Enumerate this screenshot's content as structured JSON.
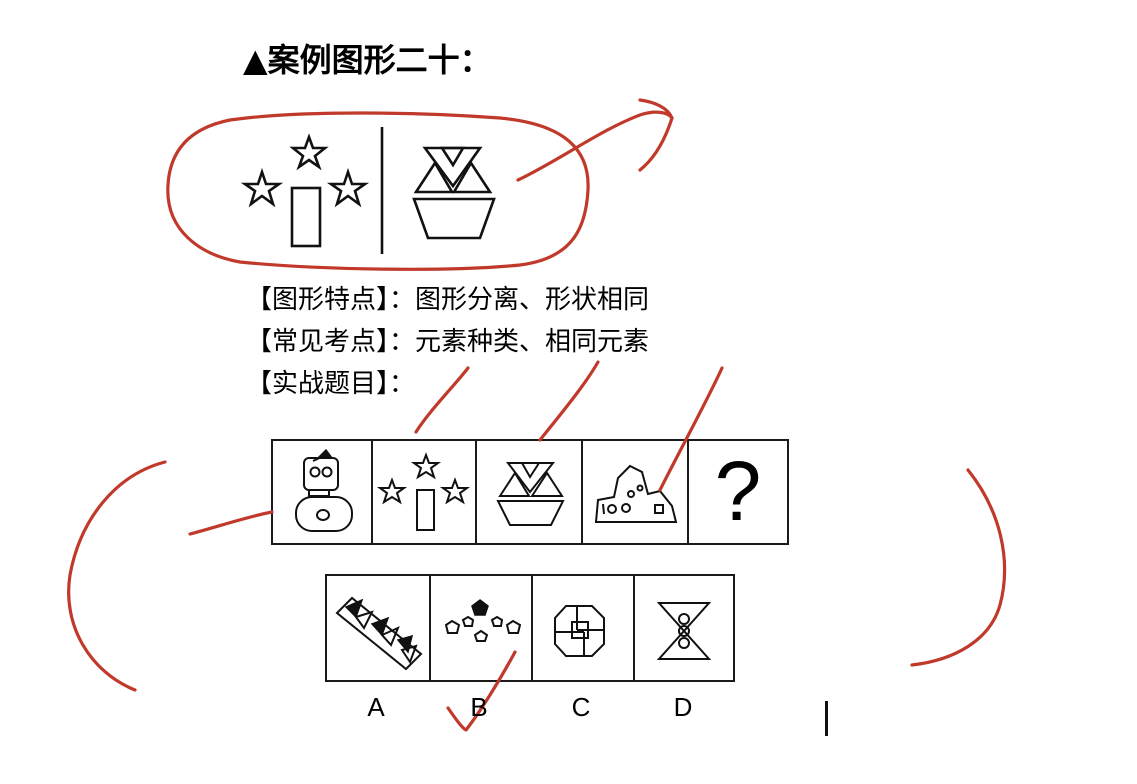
{
  "title": "▲案例图形二十：",
  "info": {
    "features": "【图形特点】：图形分离、形状相同",
    "common": "【常见考点】：元素种类、相同元素",
    "practice": "【实战题目】："
  },
  "puzzle": {
    "question_mark": "?"
  },
  "options": {
    "a": "A",
    "b": "B",
    "c": "C",
    "d": "D"
  },
  "colors": {
    "annotation": "#c0392b",
    "ink": "#111111"
  }
}
